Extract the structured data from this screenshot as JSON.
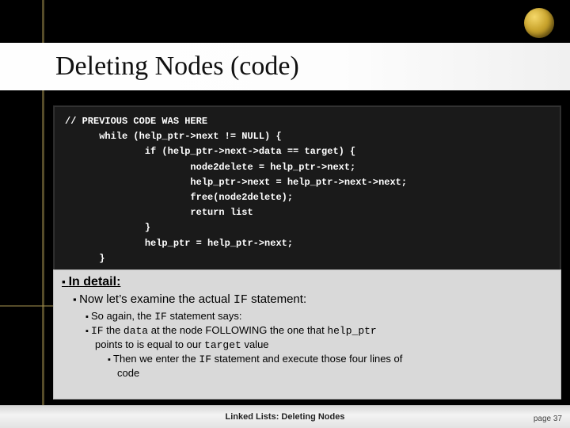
{
  "slide": {
    "title": "Deleting Nodes (code)",
    "footer_title": "Linked Lists: Deleting Nodes",
    "page_label": "page 37"
  },
  "code": {
    "text": "// PREVIOUS CODE WAS HERE\n      while (help_ptr->next != NULL) {\n              if (help_ptr->next->data == target) {\n                      node2delete = help_ptr->next;\n                      help_ptr->next = help_ptr->next->next;\n                      free(node2delete);\n                      return list\n              }\n              help_ptr = help_ptr->next;\n      }"
  },
  "detail": {
    "heading": "In detail:",
    "l1_prefix": "Now let’s examine the actual ",
    "l1_code": "IF",
    "l1_suffix": " statement:",
    "l2a_prefix": "So again, the ",
    "l2a_code": "IF",
    "l2a_suffix": " statement says:",
    "l2b_code1": "IF",
    "l2b_mid1": " the ",
    "l2b_code2": "data",
    "l2b_mid2": " at the node FOLLOWING the one that ",
    "l2b_code3": "help_ptr",
    "l2b_line2_prefix": "points to is equal to our ",
    "l2b_line2_code": "target",
    "l2b_line2_suffix": " value",
    "l3_prefix": "Then we enter the ",
    "l3_code": "IF",
    "l3_suffix": " statement and execute those four lines of",
    "l3_line2": "code"
  }
}
